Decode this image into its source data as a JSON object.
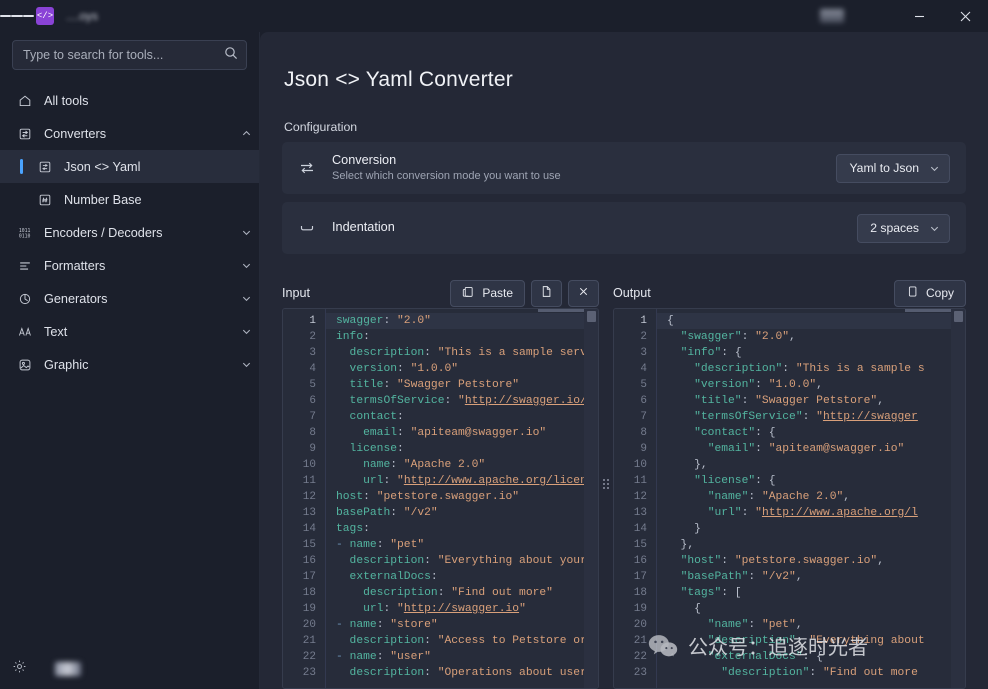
{
  "titlebar": {
    "app_name_blurred": "....oys",
    "menu_icon": "hamburger-icon",
    "logo_glyph": "</>",
    "minimize_label": "Minimize",
    "close_label": "Close"
  },
  "sidebar": {
    "search": {
      "placeholder": "Type to search for tools...",
      "value": "",
      "icon": "search-icon"
    },
    "items": [
      {
        "label": "All tools",
        "icon": "home-icon",
        "level": 0,
        "chevron": "",
        "selected": false
      },
      {
        "label": "Converters",
        "icon": "convert-icon",
        "level": 0,
        "chevron": "up",
        "selected": false
      },
      {
        "label": "Json <> Yaml",
        "icon": "json-yaml-icon",
        "level": 1,
        "chevron": "",
        "selected": true
      },
      {
        "label": "Number Base",
        "icon": "hash-icon",
        "level": 1,
        "chevron": "",
        "selected": false
      },
      {
        "label": "Encoders / Decoders",
        "icon": "binary-icon",
        "level": 0,
        "chevron": "down",
        "selected": false
      },
      {
        "label": "Formatters",
        "icon": "format-icon",
        "level": 0,
        "chevron": "down",
        "selected": false
      },
      {
        "label": "Generators",
        "icon": "generate-icon",
        "level": 0,
        "chevron": "down",
        "selected": false
      },
      {
        "label": "Text",
        "icon": "text-icon",
        "level": 0,
        "chevron": "down",
        "selected": false
      },
      {
        "label": "Graphic",
        "icon": "graphic-icon",
        "level": 0,
        "chevron": "down",
        "selected": false
      }
    ],
    "status": {
      "settings_icon": "gear-icon"
    }
  },
  "main": {
    "page_title": "Json <> Yaml Converter",
    "configuration_label": "Configuration",
    "settings": [
      {
        "icon": "swap-icon",
        "title": "Conversion",
        "subtitle": "Select which conversion mode you want to use",
        "value": "Yaml to Json"
      },
      {
        "icon": "indent-icon",
        "title": "Indentation",
        "subtitle": "",
        "value": "2 spaces"
      }
    ],
    "input_pane": {
      "label": "Input",
      "buttons": [
        {
          "label": "Paste",
          "icon": "clipboard-icon"
        },
        {
          "label": "",
          "icon": "file-icon"
        },
        {
          "label": "",
          "icon": "close-icon"
        }
      ],
      "current_line": 1,
      "lines": [
        {
          "n": 1,
          "segs": [
            {
              "t": "swagger",
              "c": "k"
            },
            {
              "t": ": ",
              "c": "p"
            },
            {
              "t": "\"2.0\"",
              "c": "s"
            }
          ]
        },
        {
          "n": 2,
          "segs": [
            {
              "t": "info",
              "c": "k"
            },
            {
              "t": ":",
              "c": "p"
            }
          ]
        },
        {
          "n": 3,
          "segs": [
            {
              "t": "  description",
              "c": "k"
            },
            {
              "t": ": ",
              "c": "p"
            },
            {
              "t": "\"This is a sample serve",
              "c": "s"
            }
          ]
        },
        {
          "n": 4,
          "segs": [
            {
              "t": "  version",
              "c": "k"
            },
            {
              "t": ": ",
              "c": "p"
            },
            {
              "t": "\"1.0.0\"",
              "c": "s"
            }
          ]
        },
        {
          "n": 5,
          "segs": [
            {
              "t": "  title",
              "c": "k"
            },
            {
              "t": ": ",
              "c": "p"
            },
            {
              "t": "\"Swagger Petstore\"",
              "c": "s"
            }
          ]
        },
        {
          "n": 6,
          "segs": [
            {
              "t": "  termsOfService",
              "c": "k"
            },
            {
              "t": ": ",
              "c": "p"
            },
            {
              "t": "\"",
              "c": "s"
            },
            {
              "t": "http://swagger.io/",
              "c": "u"
            }
          ]
        },
        {
          "n": 7,
          "segs": [
            {
              "t": "  contact",
              "c": "k"
            },
            {
              "t": ":",
              "c": "p"
            }
          ]
        },
        {
          "n": 8,
          "segs": [
            {
              "t": "    email",
              "c": "k"
            },
            {
              "t": ": ",
              "c": "p"
            },
            {
              "t": "\"apiteam@swagger.io\"",
              "c": "s"
            }
          ]
        },
        {
          "n": 9,
          "segs": [
            {
              "t": "  license",
              "c": "k"
            },
            {
              "t": ":",
              "c": "p"
            }
          ]
        },
        {
          "n": 10,
          "segs": [
            {
              "t": "    name",
              "c": "k"
            },
            {
              "t": ": ",
              "c": "p"
            },
            {
              "t": "\"Apache 2.0\"",
              "c": "s"
            }
          ]
        },
        {
          "n": 11,
          "segs": [
            {
              "t": "    url",
              "c": "k"
            },
            {
              "t": ": ",
              "c": "p"
            },
            {
              "t": "\"",
              "c": "s"
            },
            {
              "t": "http://www.apache.org/licen",
              "c": "u"
            }
          ]
        },
        {
          "n": 12,
          "segs": [
            {
              "t": "host",
              "c": "k"
            },
            {
              "t": ": ",
              "c": "p"
            },
            {
              "t": "\"petstore.swagger.io\"",
              "c": "s"
            }
          ]
        },
        {
          "n": 13,
          "segs": [
            {
              "t": "basePath",
              "c": "k"
            },
            {
              "t": ": ",
              "c": "p"
            },
            {
              "t": "\"/v2\"",
              "c": "s"
            }
          ]
        },
        {
          "n": 14,
          "segs": [
            {
              "t": "tags",
              "c": "k"
            },
            {
              "t": ":",
              "c": "p"
            }
          ]
        },
        {
          "n": 15,
          "segs": [
            {
              "t": "- ",
              "c": "d"
            },
            {
              "t": "name",
              "c": "k"
            },
            {
              "t": ": ",
              "c": "p"
            },
            {
              "t": "\"pet\"",
              "c": "s"
            }
          ]
        },
        {
          "n": 16,
          "segs": [
            {
              "t": "  description",
              "c": "k"
            },
            {
              "t": ": ",
              "c": "p"
            },
            {
              "t": "\"Everything about your",
              "c": "s"
            }
          ]
        },
        {
          "n": 17,
          "segs": [
            {
              "t": "  externalDocs",
              "c": "k"
            },
            {
              "t": ":",
              "c": "p"
            }
          ]
        },
        {
          "n": 18,
          "segs": [
            {
              "t": "    description",
              "c": "k"
            },
            {
              "t": ": ",
              "c": "p"
            },
            {
              "t": "\"Find out more\"",
              "c": "s"
            }
          ]
        },
        {
          "n": 19,
          "segs": [
            {
              "t": "    url",
              "c": "k"
            },
            {
              "t": ": ",
              "c": "p"
            },
            {
              "t": "\"",
              "c": "s"
            },
            {
              "t": "http://swagger.io",
              "c": "u"
            },
            {
              "t": "\"",
              "c": "s"
            }
          ]
        },
        {
          "n": 20,
          "segs": [
            {
              "t": "- ",
              "c": "d"
            },
            {
              "t": "name",
              "c": "k"
            },
            {
              "t": ": ",
              "c": "p"
            },
            {
              "t": "\"store\"",
              "c": "s"
            }
          ]
        },
        {
          "n": 21,
          "segs": [
            {
              "t": "  description",
              "c": "k"
            },
            {
              "t": ": ",
              "c": "p"
            },
            {
              "t": "\"Access to Petstore or",
              "c": "s"
            }
          ]
        },
        {
          "n": 22,
          "segs": [
            {
              "t": "- ",
              "c": "d"
            },
            {
              "t": "name",
              "c": "k"
            },
            {
              "t": ": ",
              "c": "p"
            },
            {
              "t": "\"user\"",
              "c": "s"
            }
          ]
        },
        {
          "n": 23,
          "segs": [
            {
              "t": "  description",
              "c": "k"
            },
            {
              "t": ": ",
              "c": "p"
            },
            {
              "t": "\"Operations about user",
              "c": "s"
            }
          ]
        }
      ]
    },
    "output_pane": {
      "label": "Output",
      "buttons": [
        {
          "label": "Copy",
          "icon": "copy-icon"
        }
      ],
      "current_line": 1,
      "lines": [
        {
          "n": 1,
          "segs": [
            {
              "t": "{",
              "c": "p"
            }
          ]
        },
        {
          "n": 2,
          "segs": [
            {
              "t": "  ",
              "c": "p"
            },
            {
              "t": "\"swagger\"",
              "c": "k"
            },
            {
              "t": ": ",
              "c": "p"
            },
            {
              "t": "\"2.0\"",
              "c": "s"
            },
            {
              "t": ",",
              "c": "p"
            }
          ]
        },
        {
          "n": 3,
          "segs": [
            {
              "t": "  ",
              "c": "p"
            },
            {
              "t": "\"info\"",
              "c": "k"
            },
            {
              "t": ": ",
              "c": "p"
            },
            {
              "t": "{",
              "c": "p"
            }
          ]
        },
        {
          "n": 4,
          "segs": [
            {
              "t": "    ",
              "c": "p"
            },
            {
              "t": "\"description\"",
              "c": "k"
            },
            {
              "t": ": ",
              "c": "p"
            },
            {
              "t": "\"This is a sample s",
              "c": "s"
            }
          ]
        },
        {
          "n": 5,
          "segs": [
            {
              "t": "    ",
              "c": "p"
            },
            {
              "t": "\"version\"",
              "c": "k"
            },
            {
              "t": ": ",
              "c": "p"
            },
            {
              "t": "\"1.0.0\"",
              "c": "s"
            },
            {
              "t": ",",
              "c": "p"
            }
          ]
        },
        {
          "n": 6,
          "segs": [
            {
              "t": "    ",
              "c": "p"
            },
            {
              "t": "\"title\"",
              "c": "k"
            },
            {
              "t": ": ",
              "c": "p"
            },
            {
              "t": "\"Swagger Petstore\"",
              "c": "s"
            },
            {
              "t": ",",
              "c": "p"
            }
          ]
        },
        {
          "n": 7,
          "segs": [
            {
              "t": "    ",
              "c": "p"
            },
            {
              "t": "\"termsOfService\"",
              "c": "k"
            },
            {
              "t": ": ",
              "c": "p"
            },
            {
              "t": "\"",
              "c": "s"
            },
            {
              "t": "http://swagger",
              "c": "u"
            }
          ]
        },
        {
          "n": 8,
          "segs": [
            {
              "t": "    ",
              "c": "p"
            },
            {
              "t": "\"contact\"",
              "c": "k"
            },
            {
              "t": ": ",
              "c": "p"
            },
            {
              "t": "{",
              "c": "p"
            }
          ]
        },
        {
          "n": 9,
          "segs": [
            {
              "t": "      ",
              "c": "p"
            },
            {
              "t": "\"email\"",
              "c": "k"
            },
            {
              "t": ": ",
              "c": "p"
            },
            {
              "t": "\"apiteam@swagger.io\"",
              "c": "s"
            }
          ]
        },
        {
          "n": 10,
          "segs": [
            {
              "t": "    },",
              "c": "p"
            }
          ]
        },
        {
          "n": 11,
          "segs": [
            {
              "t": "    ",
              "c": "p"
            },
            {
              "t": "\"license\"",
              "c": "k"
            },
            {
              "t": ": ",
              "c": "p"
            },
            {
              "t": "{",
              "c": "p"
            }
          ]
        },
        {
          "n": 12,
          "segs": [
            {
              "t": "      ",
              "c": "p"
            },
            {
              "t": "\"name\"",
              "c": "k"
            },
            {
              "t": ": ",
              "c": "p"
            },
            {
              "t": "\"Apache 2.0\"",
              "c": "s"
            },
            {
              "t": ",",
              "c": "p"
            }
          ]
        },
        {
          "n": 13,
          "segs": [
            {
              "t": "      ",
              "c": "p"
            },
            {
              "t": "\"url\"",
              "c": "k"
            },
            {
              "t": ": ",
              "c": "p"
            },
            {
              "t": "\"",
              "c": "s"
            },
            {
              "t": "http://www.apache.org/l",
              "c": "u"
            }
          ]
        },
        {
          "n": 14,
          "segs": [
            {
              "t": "    }",
              "c": "p"
            }
          ]
        },
        {
          "n": 15,
          "segs": [
            {
              "t": "  },",
              "c": "p"
            }
          ]
        },
        {
          "n": 16,
          "segs": [
            {
              "t": "  ",
              "c": "p"
            },
            {
              "t": "\"host\"",
              "c": "k"
            },
            {
              "t": ": ",
              "c": "p"
            },
            {
              "t": "\"petstore.swagger.io\"",
              "c": "s"
            },
            {
              "t": ",",
              "c": "p"
            }
          ]
        },
        {
          "n": 17,
          "segs": [
            {
              "t": "  ",
              "c": "p"
            },
            {
              "t": "\"basePath\"",
              "c": "k"
            },
            {
              "t": ": ",
              "c": "p"
            },
            {
              "t": "\"/v2\"",
              "c": "s"
            },
            {
              "t": ",",
              "c": "p"
            }
          ]
        },
        {
          "n": 18,
          "segs": [
            {
              "t": "  ",
              "c": "p"
            },
            {
              "t": "\"tags\"",
              "c": "k"
            },
            {
              "t": ": [",
              "c": "p"
            }
          ]
        },
        {
          "n": 19,
          "segs": [
            {
              "t": "    {",
              "c": "p"
            }
          ]
        },
        {
          "n": 20,
          "segs": [
            {
              "t": "      ",
              "c": "p"
            },
            {
              "t": "\"name\"",
              "c": "k"
            },
            {
              "t": ": ",
              "c": "p"
            },
            {
              "t": "\"pet\"",
              "c": "s"
            },
            {
              "t": ",",
              "c": "p"
            }
          ]
        },
        {
          "n": 21,
          "segs": [
            {
              "t": "      ",
              "c": "p"
            },
            {
              "t": "\"description\"",
              "c": "k"
            },
            {
              "t": ": ",
              "c": "p"
            },
            {
              "t": "\"Everything about",
              "c": "s"
            }
          ]
        },
        {
          "n": 22,
          "segs": [
            {
              "t": "      ",
              "c": "p"
            },
            {
              "t": "\"externalDocs\"",
              "c": "k"
            },
            {
              "t": ": {",
              "c": "p"
            }
          ]
        },
        {
          "n": 23,
          "segs": [
            {
              "t": "        ",
              "c": "p"
            },
            {
              "t": "\"description\"",
              "c": "k"
            },
            {
              "t": ": ",
              "c": "p"
            },
            {
              "t": "\"Find out more",
              "c": "s"
            }
          ]
        }
      ]
    }
  },
  "watermark": {
    "text": "公众号：追逐时光者",
    "logo": "wechat-icon"
  },
  "colors": {
    "accent": "#4aa3ff",
    "window_bg": "#1b1f2b",
    "main_bg": "#242836",
    "card_bg": "#2a2f3e",
    "editor_bg": "#272c3a",
    "key": "#53b5a0",
    "string": "#d9a07a",
    "logo_purple": "#8a43d6"
  }
}
